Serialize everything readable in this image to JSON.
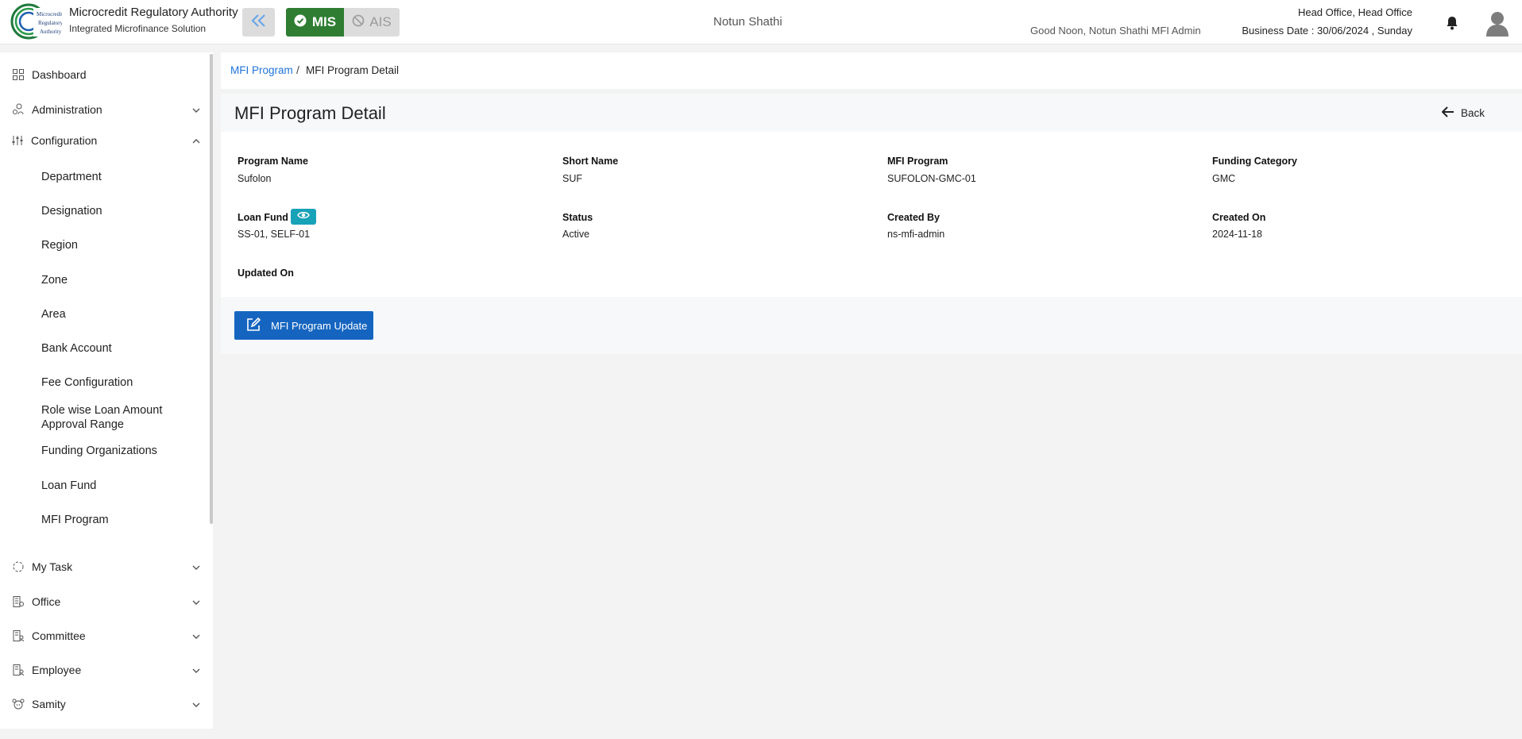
{
  "header": {
    "logo_text": "Microcredit Regulatory Authority",
    "title": "Microcredit Regulatory Authority",
    "subtitle": "Integrated Microfinance Solution",
    "mis_label": "MIS",
    "ais_label": "AIS",
    "org_name": "Notun Shathi",
    "greeting": "Good Noon, Notun Shathi MFI Admin",
    "office": "Head Office, Head Office",
    "business_date": "Business Date : 30/06/2024 , Sunday",
    "colors": {
      "mis": "#2e7d32",
      "link": "#1e73d8",
      "primary": "#1565c0",
      "info": "#17a2b8"
    }
  },
  "sidebar": {
    "items": [
      {
        "label": "Dashboard",
        "icon": "dashboard-grid-icon"
      },
      {
        "label": "Administration",
        "icon": "admin-users-icon"
      },
      {
        "label": "Configuration",
        "icon": "sliders-icon"
      },
      {
        "label": "My Task",
        "icon": "task-circle-icon"
      },
      {
        "label": "Office",
        "icon": "office-icon"
      },
      {
        "label": "Committee",
        "icon": "committee-icon"
      },
      {
        "label": "Employee",
        "icon": "employee-icon"
      },
      {
        "label": "Samity",
        "icon": "samity-icon"
      }
    ],
    "config_sub": [
      "Department",
      "Designation",
      "Region",
      "Zone",
      "Area",
      "Bank Account",
      "Fee Configuration",
      "Role wise Loan Amount Approval Range",
      "Funding Organizations",
      "Loan Fund",
      "MFI Program"
    ]
  },
  "breadcrumb": {
    "parent": "MFI Program",
    "separator": "/",
    "current": "MFI Program Detail"
  },
  "main": {
    "title": "MFI Program Detail",
    "back_label": "Back",
    "fields": [
      {
        "label": "Program Name",
        "value": "Sufolon"
      },
      {
        "label": "Short Name",
        "value": "SUF"
      },
      {
        "label": "MFI Program",
        "value": "SUFOLON-GMC-01"
      },
      {
        "label": "Funding Category",
        "value": "GMC"
      },
      {
        "label": "Loan Fund",
        "value": "SS-01, SELF-01"
      },
      {
        "label": "Status",
        "value": "Active"
      },
      {
        "label": "Created By",
        "value": "ns-mfi-admin"
      },
      {
        "label": "Created On",
        "value": "2024-11-18"
      },
      {
        "label": "Updated On",
        "value": ""
      }
    ],
    "update_button": "MFI Program Update"
  }
}
